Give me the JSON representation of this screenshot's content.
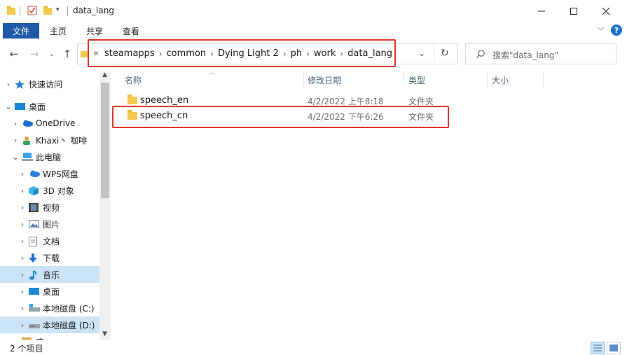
{
  "window": {
    "title": "data_lang",
    "colors": {
      "accent": "#1f5aa8",
      "highlight_box": "#e0352b",
      "selection": "#cce4f7"
    }
  },
  "ribbon": {
    "tabs": [
      "文件",
      "主页",
      "共享",
      "查看"
    ],
    "help": "?"
  },
  "address": {
    "overflow": "«",
    "crumbs": [
      "steamapps",
      "common",
      "Dying Light 2",
      "ph",
      "work",
      "data_lang"
    ]
  },
  "search": {
    "placeholder": "搜索\"data_lang\""
  },
  "nav": {
    "items": [
      {
        "label": "快速访问",
        "icon": "star-icon"
      },
      {
        "label": "桌面",
        "icon": "desktop-icon"
      },
      {
        "label": "OneDrive",
        "icon": "cloud-icon"
      },
      {
        "label": "Khaxi丶 咖啡",
        "icon": "user-icon"
      },
      {
        "label": "此电脑",
        "icon": "computer-icon"
      },
      {
        "label": "WPS网盘",
        "icon": "cloud-icon"
      },
      {
        "label": "3D 对象",
        "icon": "cube-icon"
      },
      {
        "label": "视频",
        "icon": "video-icon"
      },
      {
        "label": "图片",
        "icon": "picture-icon"
      },
      {
        "label": "文档",
        "icon": "document-icon"
      },
      {
        "label": "下载",
        "icon": "download-icon"
      },
      {
        "label": "音乐",
        "icon": "music-icon"
      },
      {
        "label": "桌面",
        "icon": "desktop-icon"
      },
      {
        "label": "本地磁盘 (C:)",
        "icon": "drive-icon"
      },
      {
        "label": "本地磁盘 (D:)",
        "icon": "drive-icon"
      },
      {
        "label": "库",
        "icon": "library-icon"
      }
    ]
  },
  "columns": {
    "name": "名称",
    "date": "修改日期",
    "type": "类型",
    "size": "大小"
  },
  "files": [
    {
      "name": "speech_en",
      "date": "4/2/2022 上午8:18",
      "type": "文件夹"
    },
    {
      "name": "speech_cn",
      "date": "4/2/2022 下午6:26",
      "type": "文件夹"
    }
  ],
  "status": {
    "count": "2 个项目"
  }
}
